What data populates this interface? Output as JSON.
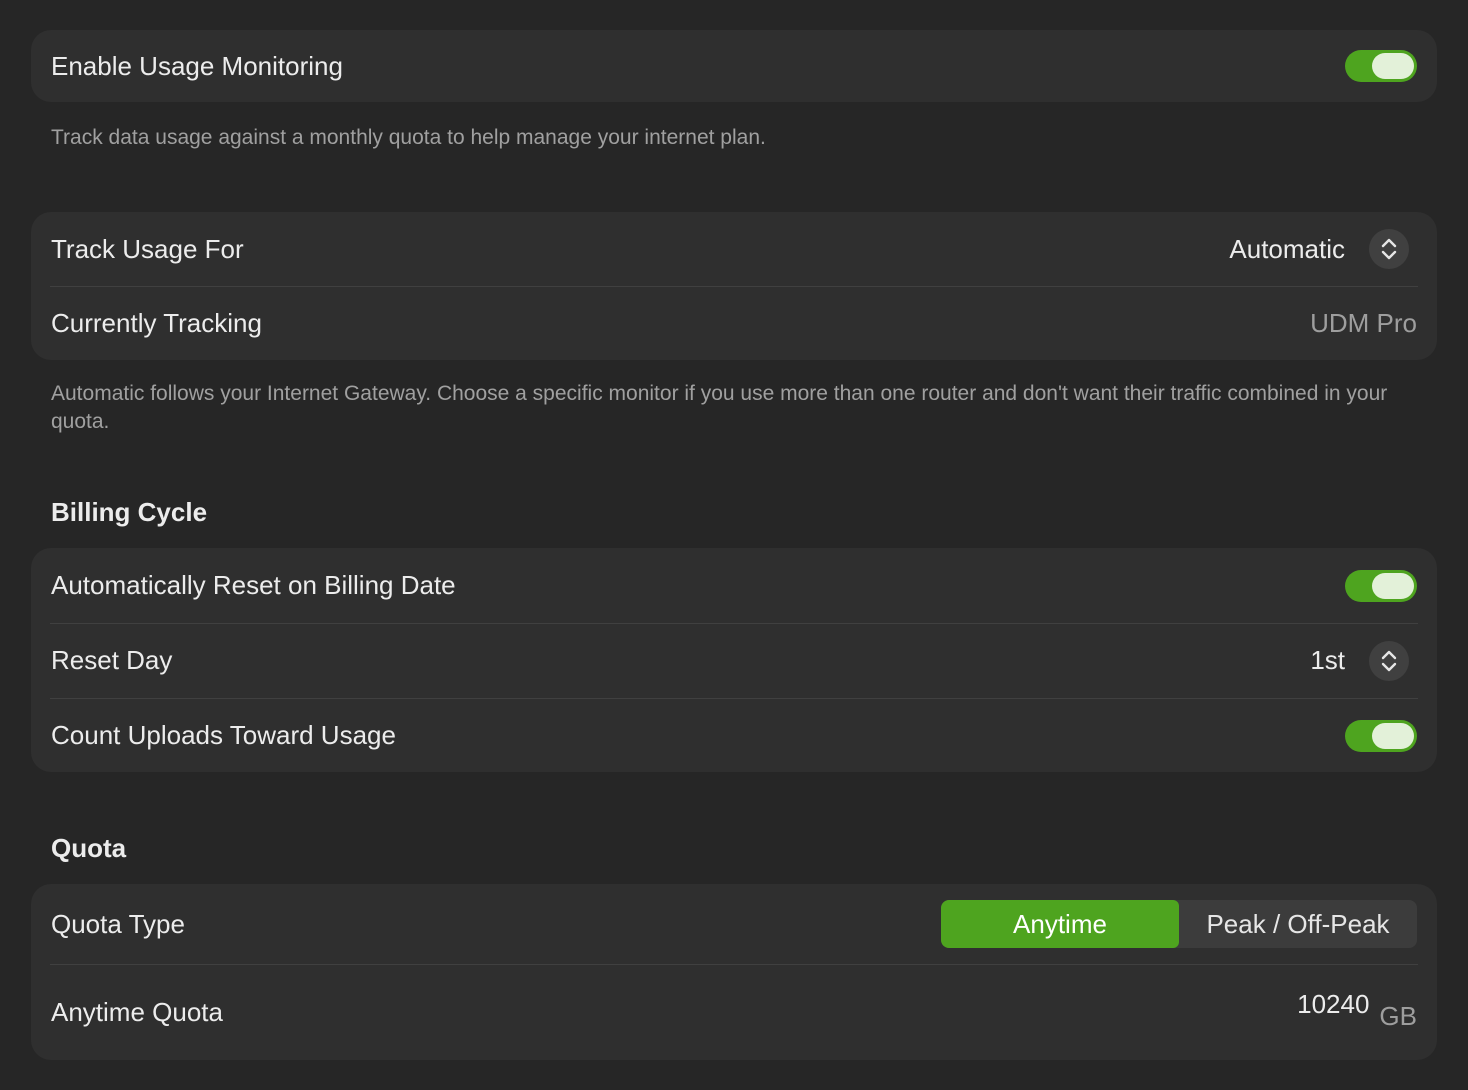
{
  "monitoring": {
    "enable_label": "Enable Usage Monitoring",
    "enable_on": true,
    "description": "Track data usage against a monthly quota to help manage your internet plan."
  },
  "tracking": {
    "track_for_label": "Track Usage For",
    "track_for_value": "Automatic",
    "currently_label": "Currently Tracking",
    "currently_value": "UDM Pro",
    "description": "Automatic follows your Internet Gateway. Choose a specific monitor if you use more than one router and don't want their traffic combined in your quota."
  },
  "billing": {
    "title": "Billing Cycle",
    "auto_reset_label": "Automatically Reset on Billing Date",
    "auto_reset_on": true,
    "reset_day_label": "Reset Day",
    "reset_day_value": "1st",
    "count_uploads_label": "Count Uploads Toward Usage",
    "count_uploads_on": true
  },
  "quota": {
    "title": "Quota",
    "type_label": "Quota Type",
    "options": [
      "Anytime",
      "Peak / Off-Peak"
    ],
    "selected": "Anytime",
    "anytime_label": "Anytime Quota",
    "anytime_value": "10240",
    "unit": "GB"
  },
  "colors": {
    "accent": "#4ea41f",
    "background": "#262626",
    "card": "#2f2f2f"
  },
  "icons": {
    "popup_stepper": "chevron-up-down-icon"
  }
}
